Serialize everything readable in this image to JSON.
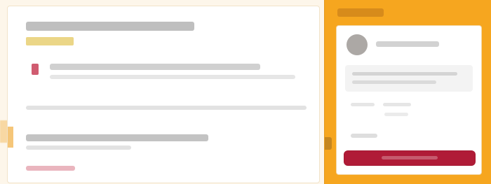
{
  "theme": {
    "accent": "#f6a61f",
    "panel_bg": "#ffffff",
    "alert_color": "#c4334c",
    "button_color": "#b01b37"
  },
  "left": {
    "title": "",
    "tag": "",
    "alert_text": "",
    "alert_sub": "",
    "row_text": "",
    "cta_title": "",
    "cta_sub": "",
    "link": ""
  },
  "right": {
    "header": "",
    "profile_name": "",
    "message_line_1": "",
    "message_line_2": "",
    "small_1": "",
    "small_2": "",
    "small_3": "",
    "subtitle": "",
    "button_label": ""
  }
}
